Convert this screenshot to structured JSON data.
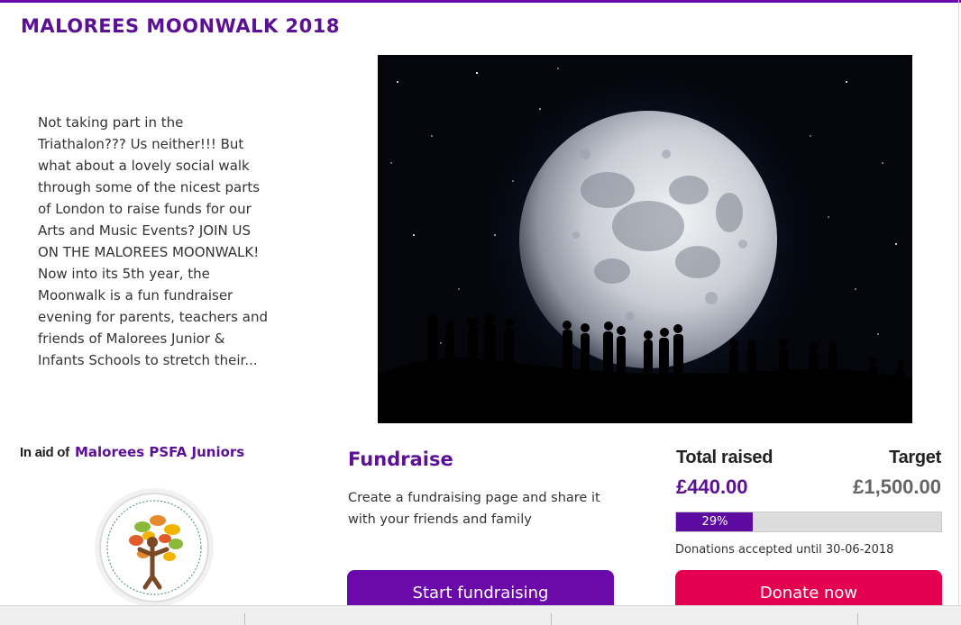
{
  "page": {
    "title": "MALOREES MOONWALK 2018"
  },
  "description": "Not taking part in the Triathalon??? Us neither!!!   But what about a lovely social walk through some of the nicest parts of London to raise funds for our Arts and Music Events?  JOIN US ON THE MALOREES MOONWALK! Now into its 5th year, the Moonwalk is a fun fundraiser evening for parents, teachers and friends of Malorees Junior & Infants Schools to stretch their...",
  "charity": {
    "prefix": "In aid of",
    "name": "Malorees PSFA Juniors",
    "logo_ring_words": "TEAMWORK · HAPPINESS · RESPECT · INDIVIDUALITY · VIBRANT · INSPIRATION · NURTURE · GROWTH"
  },
  "fundraise": {
    "heading": "Fundraise",
    "text": "Create a fundraising page and share it with your friends and family",
    "button_label": "Start fundraising"
  },
  "totals": {
    "raised_label": "Total raised",
    "raised_amount": "£440.00",
    "target_label": "Target",
    "target_amount": "£1,500.00",
    "progress_percent": 29,
    "progress_text": "29%",
    "deadline": "Donations accepted until 30-06-2018",
    "donate_label": "Donate now"
  },
  "colors": {
    "brand_purple": "#6a0aab",
    "donate_pink": "#e5004f"
  }
}
